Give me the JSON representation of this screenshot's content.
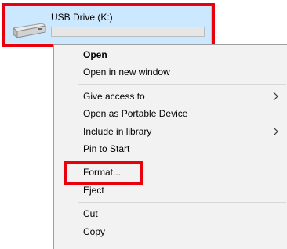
{
  "drive": {
    "label": "USB Drive (K:)",
    "usage_fraction": 0,
    "icon": "usb-drive-icon"
  },
  "menu": {
    "items": [
      {
        "label": "Open",
        "bold": true
      },
      {
        "label": "Open in new window"
      },
      {
        "label": "Give access to",
        "submenu": true
      },
      {
        "label": "Open as Portable Device"
      },
      {
        "label": "Include in library",
        "submenu": true
      },
      {
        "label": "Pin to Start"
      },
      {
        "label": "Format..."
      },
      {
        "label": "Eject"
      },
      {
        "label": "Cut"
      },
      {
        "label": "Copy"
      }
    ]
  },
  "colors": {
    "highlight_box": "#e8000d",
    "drive_selected_bg": "#cce8ff",
    "menu_bg": "#f2f2f2"
  }
}
